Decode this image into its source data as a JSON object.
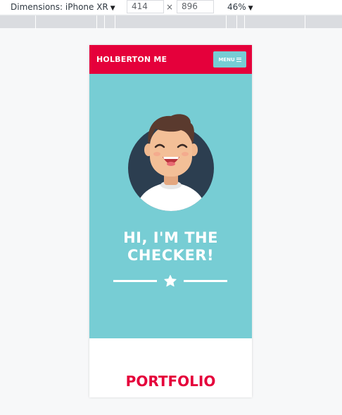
{
  "devtools": {
    "dimensions_label": "Dimensions: iPhone XR",
    "width_value": "414",
    "times": "×",
    "height_value": "896",
    "zoom_label": "46%"
  },
  "page": {
    "brand": "HOLBERTON ME",
    "menu_label": "MENU",
    "hero_title_line1": "HI, I'M THE",
    "hero_title_line2": "CHECKER!",
    "section_title": "PORTFOLIO"
  },
  "colors": {
    "nav_red": "#e5003b",
    "hero_teal": "#77cdd4",
    "avatar_bg": "#2c3e50",
    "white": "#ffffff"
  },
  "icons": {
    "menu": "hamburger-icon",
    "divider": "star-icon",
    "caret": "caret-down-icon"
  }
}
